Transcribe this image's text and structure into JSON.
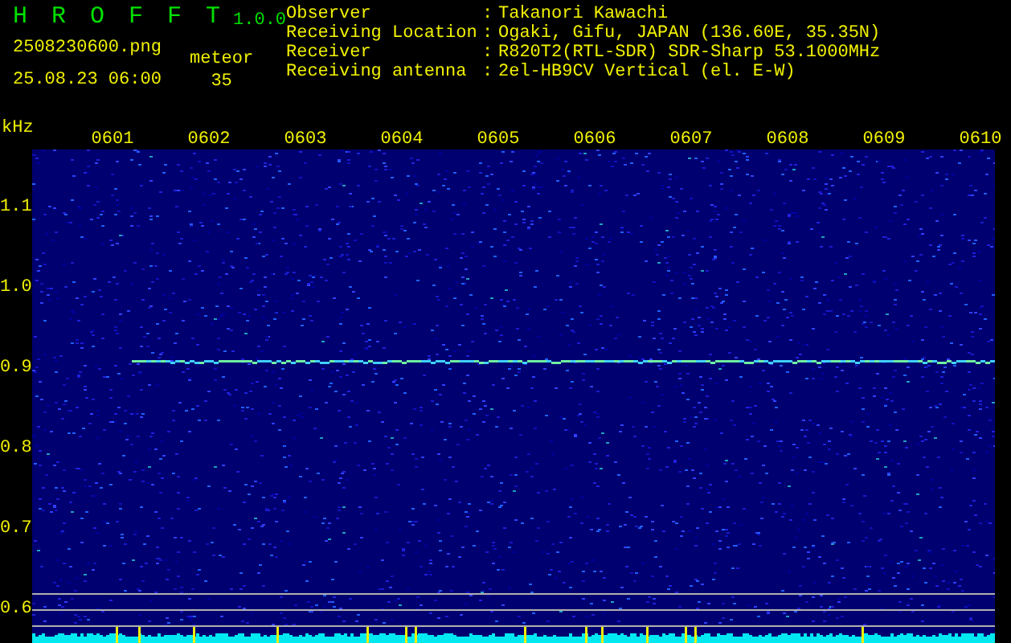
{
  "app": {
    "name": "H R O F F T",
    "version": "1.0.0"
  },
  "file": "2508230600.png",
  "datetime": "25.08.23 06:00",
  "meteor": {
    "label": "meteor",
    "count": "35"
  },
  "info": [
    {
      "label": "Observer",
      "separator": ":",
      "value": "Takanori Kawachi"
    },
    {
      "label": "Receiving Location",
      "separator": ":",
      "value": "Ogaki, Gifu, JAPAN (136.60E, 35.35N)"
    },
    {
      "label": "Receiver",
      "separator": ":",
      "value": "R820T2(RTL-SDR) SDR-Sharp 53.1000MHz"
    },
    {
      "label": "Receiving antenna",
      "separator": ":",
      "value": "2el-HB9CV Vertical (el. E-W)"
    }
  ],
  "spectrogram": {
    "unit": "kHz",
    "time_labels": [
      "0601",
      "0602",
      "0603",
      "0604",
      "0605",
      "0606",
      "0607",
      "0608",
      "0609",
      "0610"
    ],
    "freq_labels": [
      "1.1",
      "1.0",
      "0.9",
      "0.8",
      "0.7",
      "0.6"
    ]
  }
}
